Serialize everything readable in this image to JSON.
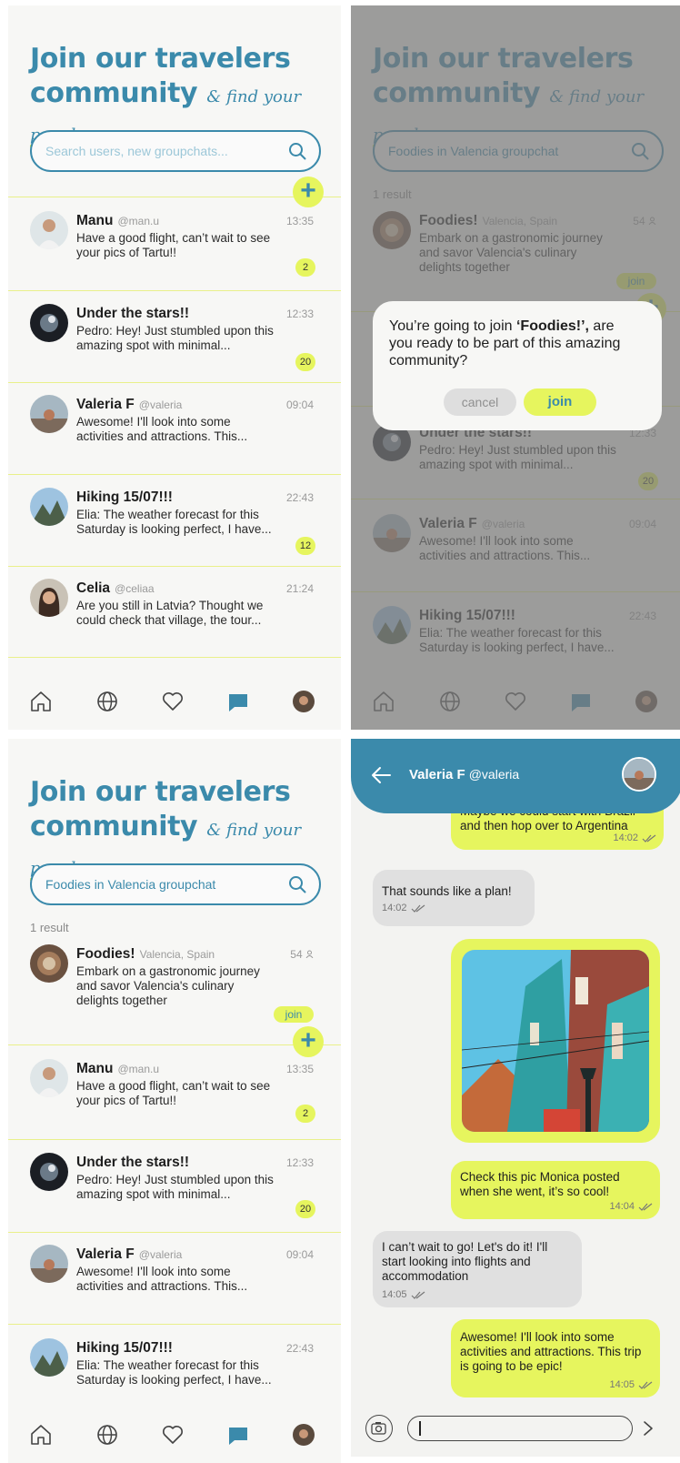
{
  "brand": {
    "accent": "#3b8aab",
    "highlight": "#e6f55e"
  },
  "header": {
    "title_line1": "Join our travelers",
    "title_line2": "community",
    "tagline_amp": "&",
    "tagline_find": "find",
    "tagline_your": "your",
    "tagline_people": "people"
  },
  "search": {
    "placeholder": "Search users, new groupchats...",
    "query": "Foodies in Valencia groupchat"
  },
  "results": {
    "count_label": "1 result",
    "group": {
      "name": "Foodies!",
      "location": "Valencia, Spain",
      "members": "54",
      "description": "Embark on a gastronomic journey and savor Valencia's culinary delights together",
      "join_label": "join"
    }
  },
  "chats": [
    {
      "name": "Manu",
      "handle": "@man.u",
      "time": "13:35",
      "preview": "Have a good flight, can’t wait to see your pics of Tartu!!",
      "unread": "2"
    },
    {
      "name": "Under the stars!!",
      "handle": "",
      "time": "12:33",
      "preview": "Pedro: Hey! Just stumbled upon this amazing spot with minimal...",
      "unread": "20"
    },
    {
      "name": "Valeria F",
      "handle": "@valeria",
      "time": "09:04",
      "preview": "Awesome! I'll look into some activities and attractions. This...",
      "unread": ""
    },
    {
      "name": "Hiking 15/07!!!",
      "handle": "",
      "time": "22:43",
      "preview": "Elia: The weather forecast for this Saturday is looking perfect, I have...",
      "unread": "12"
    },
    {
      "name": "Celia",
      "handle": "@celiaa",
      "time": "21:24",
      "preview": "Are you still in Latvia? Thought we could check that village, the tour...",
      "unread": ""
    }
  ],
  "dialog": {
    "text_before": "You’re going to join ",
    "group_name": "‘Foodies!’,",
    "text_after": " are you ready to be part of this amazing community?",
    "cancel_label": "cancel",
    "join_label": "join"
  },
  "nav": {
    "icons": [
      "home-icon",
      "globe-icon",
      "heart-icon",
      "chat-icon",
      "profile-avatar"
    ]
  },
  "chat": {
    "contact_name": "Valeria F",
    "contact_handle": "@valeria",
    "messages": [
      {
        "dir": "out",
        "text": "Maybe we could start with Brazil and then hop over to Argentina",
        "time": "14:02"
      },
      {
        "dir": "in",
        "text": "That sounds like a plan!",
        "time": "14:02"
      },
      {
        "dir": "out",
        "type": "image",
        "alt": "Colorful buildings street photo"
      },
      {
        "dir": "out",
        "text": "Check this pic Monica posted when she went, it’s so cool!",
        "time": "14:04"
      },
      {
        "dir": "in",
        "text": "I can’t wait to go! Let's do it! I'll start looking into flights and accommodation",
        "time": "14:05"
      },
      {
        "dir": "out",
        "text": "Awesome! I'll look into some activities and attractions. This trip is going to be epic!",
        "time": "14:05"
      }
    ],
    "input_value": ""
  }
}
